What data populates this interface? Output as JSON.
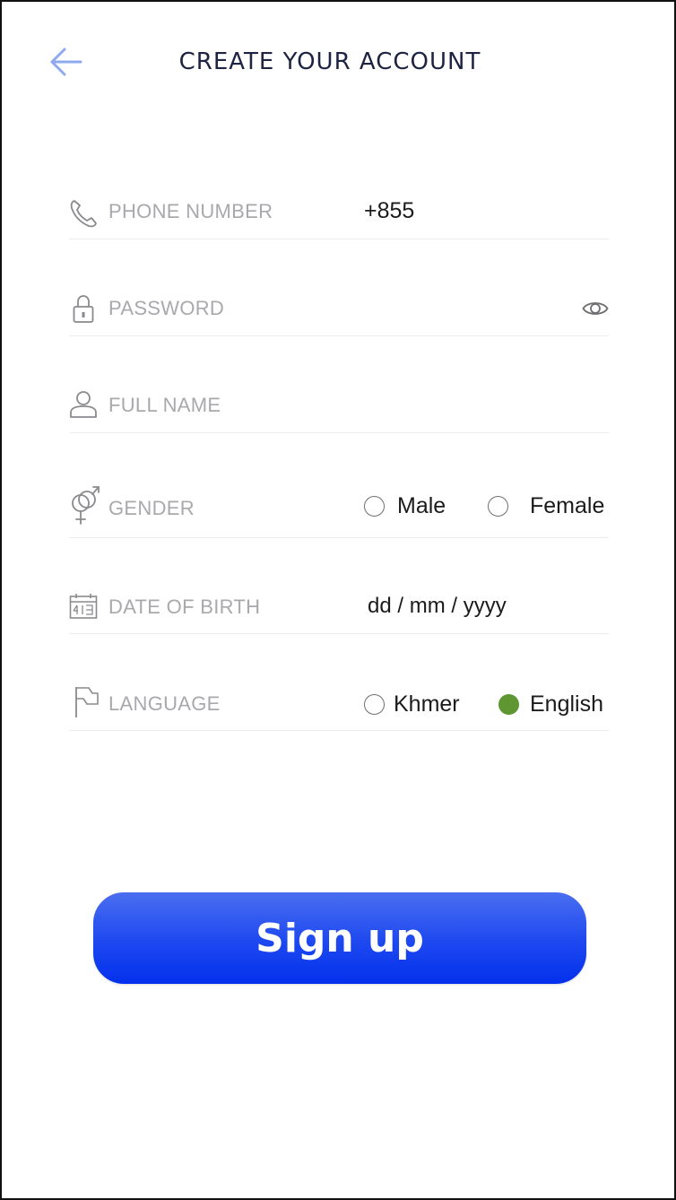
{
  "header": {
    "title": "CREATE YOUR ACCOUNT",
    "back_icon": "arrow-left-icon",
    "accent_color": "#8ea9ee"
  },
  "form": {
    "phone": {
      "icon": "phone-icon",
      "label": "PHONE NUMBER",
      "value": "+855"
    },
    "password": {
      "icon": "lock-icon",
      "label": "PASSWORD",
      "toggle_icon": "eye-icon"
    },
    "full_name": {
      "icon": "user-icon",
      "label": "FULL NAME"
    },
    "gender": {
      "icon": "gender-icon",
      "label": "GENDER",
      "options": [
        {
          "label": "Male",
          "selected": false
        },
        {
          "label": "Female",
          "selected": false
        }
      ]
    },
    "dob": {
      "icon": "calendar-icon",
      "label": "DATE OF BIRTH",
      "placeholder": "dd / mm / yyyy"
    },
    "language": {
      "icon": "flag-icon",
      "label": "LANGUAGE",
      "options": [
        {
          "label": "Khmer",
          "selected": false
        },
        {
          "label": "English",
          "selected": true
        }
      ],
      "selected_color": "#5f9632"
    }
  },
  "signup": {
    "label": "Sign up",
    "color": "#1d48f0"
  }
}
